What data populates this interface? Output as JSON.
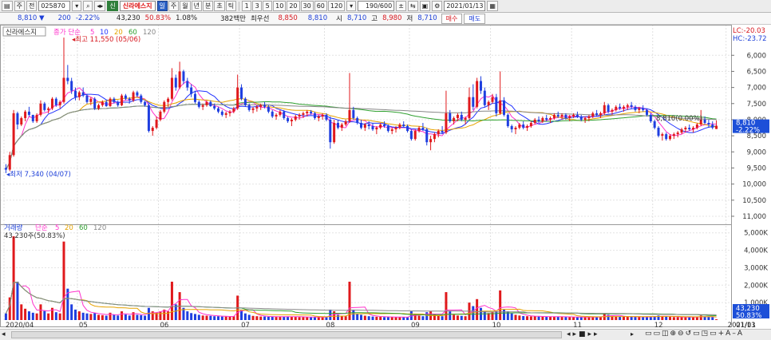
{
  "toolbar": {
    "market": "주",
    "board": "전",
    "code": "025870",
    "badge": "신",
    "stock_name": "신라에스지",
    "periods": [
      "일",
      "주",
      "월",
      "년",
      "분",
      "초",
      "틱"
    ],
    "active_period": "일",
    "intervals": [
      "1",
      "3",
      "5",
      "10",
      "20",
      "30",
      "60",
      "120"
    ],
    "count": "190/600",
    "date": "2021/01/13"
  },
  "quote": {
    "price": "8,810",
    "direction": "▼",
    "change": "200",
    "change_rate": "-2.22%",
    "volume": "43,230",
    "volume_ratio": "50.83%",
    "turnover": "1.08%",
    "amount": "382백만",
    "pref_label": "최우선",
    "ask": "8,850",
    "bid": "8,810",
    "open_label": "시",
    "open": "8,710",
    "high_label": "고",
    "high": "8,980",
    "low_label": "저",
    "low": "8,710",
    "buy_label": "매수",
    "sell_label": "매도"
  },
  "price_panel": {
    "stock_label": "신라에스지",
    "ma_title": "종가 단순",
    "ma_periods": [
      "5",
      "10",
      "20",
      "60",
      "120"
    ],
    "ma_colors": [
      "#ff33cc",
      "#2233ff",
      "#e6a300",
      "#2fa02f",
      "#888888"
    ],
    "lc": "LC:-20.03",
    "hc": "HC:-23.72",
    "max_note": "최고 11,550 (05/06)",
    "min_note": "최저 7,340 (04/07)",
    "mid_note": "8,810(0.00%)",
    "y_ticks": [
      "11,000",
      "10,500",
      "10,000",
      "9,500",
      "9,000",
      "8,500",
      "8,000",
      "7,500",
      "7,000",
      "6,500",
      "6,000"
    ],
    "current_price": "8,810",
    "current_rate": "-2.22%"
  },
  "volume_panel": {
    "title": "거래량",
    "ma_title": "단순",
    "ma_periods": [
      "5",
      "20",
      "60",
      "120"
    ],
    "current_note": "43,230주(50.83%)",
    "y_ticks": [
      "5,000K",
      "4,000K",
      "3,000K",
      "2,000K",
      "1,000K"
    ],
    "current_volume": "43,230",
    "current_rate": "50.83%"
  },
  "x_axis": {
    "labels": [
      "2020/04",
      "05",
      "06",
      "07",
      "08",
      "09",
      "10",
      "11",
      "12",
      "2021/01"
    ],
    "right_label": "01/13"
  },
  "chart_data": {
    "type": "candlestick",
    "title": "",
    "period": "2020/04 ~ 2021/01/13",
    "price_axis": {
      "ylim": [
        5900,
        11800
      ],
      "ticks": [
        6000,
        6500,
        7000,
        7500,
        8000,
        8500,
        9000,
        9500,
        10000,
        10500,
        11000
      ]
    },
    "volume_axis": {
      "ylim": [
        0,
        5400
      ],
      "unit": "K",
      "ticks": [
        1000,
        2000,
        3000,
        4000,
        5000
      ]
    },
    "candles": [
      [
        7500,
        7620,
        7340,
        7450,
        380
      ],
      [
        7450,
        8000,
        7400,
        7900,
        1300
      ],
      [
        7900,
        9300,
        7850,
        9200,
        4800
      ],
      [
        9200,
        9250,
        8700,
        8850,
        2200
      ],
      [
        8850,
        9100,
        8800,
        9050,
        900
      ],
      [
        9050,
        9300,
        8950,
        9250,
        650
      ],
      [
        9250,
        9400,
        9100,
        9150,
        500
      ],
      [
        9150,
        9150,
        8900,
        8950,
        420
      ],
      [
        8950,
        9200,
        8900,
        9150,
        380
      ],
      [
        9150,
        9600,
        9100,
        9500,
        900
      ],
      [
        9500,
        9550,
        9250,
        9300,
        520
      ],
      [
        9300,
        9400,
        9200,
        9350,
        380
      ],
      [
        9350,
        9700,
        9300,
        9650,
        700
      ],
      [
        9650,
        9700,
        9400,
        9450,
        450
      ],
      [
        9450,
        9600,
        9350,
        9550,
        380
      ],
      [
        9550,
        11550,
        9500,
        10300,
        4500
      ],
      [
        10300,
        10700,
        10100,
        10200,
        1800
      ],
      [
        10200,
        10300,
        9800,
        9900,
        900
      ],
      [
        9900,
        10000,
        9600,
        9700,
        600
      ],
      [
        9700,
        9900,
        9600,
        9850,
        500
      ],
      [
        9850,
        10000,
        9700,
        9750,
        420
      ],
      [
        9750,
        9800,
        9500,
        9550,
        380
      ],
      [
        9550,
        9700,
        9450,
        9650,
        350
      ],
      [
        9650,
        9700,
        9300,
        9350,
        400
      ],
      [
        9350,
        9500,
        9300,
        9450,
        300
      ],
      [
        9450,
        9600,
        9400,
        9550,
        280
      ],
      [
        9550,
        9600,
        9400,
        9420,
        250
      ],
      [
        9420,
        9700,
        9400,
        9650,
        420
      ],
      [
        9650,
        9700,
        9500,
        9550,
        300
      ],
      [
        9550,
        9600,
        9400,
        9450,
        260
      ],
      [
        9450,
        9800,
        9420,
        9750,
        500
      ],
      [
        9750,
        9800,
        9600,
        9650,
        320
      ],
      [
        9650,
        9700,
        9500,
        9600,
        260
      ],
      [
        9600,
        9900,
        9550,
        9850,
        450
      ],
      [
        9850,
        9900,
        9700,
        9750,
        300
      ],
      [
        9750,
        9800,
        9500,
        9550,
        280
      ],
      [
        9550,
        9600,
        9400,
        9450,
        250
      ],
      [
        9450,
        9500,
        8600,
        8650,
        700
      ],
      [
        8650,
        8800,
        8500,
        8750,
        500
      ],
      [
        8750,
        9100,
        8700,
        9000,
        420
      ],
      [
        9000,
        9300,
        8950,
        9250,
        500
      ],
      [
        9250,
        9600,
        9200,
        9550,
        600
      ],
      [
        9550,
        9700,
        9400,
        9650,
        500
      ],
      [
        9650,
        10600,
        9600,
        10300,
        2200
      ],
      [
        10300,
        10400,
        9900,
        10000,
        900
      ],
      [
        10000,
        10800,
        9950,
        10500,
        1600
      ],
      [
        10500,
        10550,
        10100,
        10200,
        700
      ],
      [
        10200,
        10300,
        9900,
        10000,
        500
      ],
      [
        10000,
        10100,
        9700,
        9800,
        400
      ],
      [
        9800,
        9900,
        9500,
        9550,
        350
      ],
      [
        9550,
        9600,
        9350,
        9400,
        300
      ],
      [
        9400,
        9500,
        9300,
        9450,
        260
      ],
      [
        9450,
        9600,
        9400,
        9550,
        250
      ],
      [
        9550,
        9600,
        9400,
        9420,
        240
      ],
      [
        9420,
        9500,
        9300,
        9350,
        220
      ],
      [
        9350,
        9400,
        9200,
        9250,
        220
      ],
      [
        9250,
        9300,
        9100,
        9150,
        200
      ],
      [
        9150,
        9250,
        9050,
        9200,
        200
      ],
      [
        9200,
        9300,
        9100,
        9250,
        190
      ],
      [
        9250,
        9400,
        9200,
        9350,
        220
      ],
      [
        9350,
        10400,
        9300,
        10000,
        1400
      ],
      [
        10000,
        10100,
        9600,
        9650,
        600
      ],
      [
        9650,
        9700,
        9400,
        9450,
        380
      ],
      [
        9450,
        9500,
        9250,
        9300,
        300
      ],
      [
        9300,
        9400,
        9200,
        9350,
        240
      ],
      [
        9350,
        9450,
        9250,
        9400,
        220
      ],
      [
        9400,
        9500,
        9300,
        9450,
        200
      ],
      [
        9450,
        9550,
        9350,
        9400,
        200
      ],
      [
        9400,
        9450,
        9200,
        9250,
        190
      ],
      [
        9250,
        9300,
        9050,
        9100,
        200
      ],
      [
        9100,
        9200,
        9000,
        9150,
        180
      ],
      [
        9150,
        9300,
        9100,
        9250,
        200
      ],
      [
        9250,
        9300,
        9000,
        9050,
        200
      ],
      [
        9050,
        9100,
        8900,
        8950,
        210
      ],
      [
        8950,
        9050,
        8800,
        9000,
        200
      ],
      [
        9000,
        9150,
        8950,
        9100,
        180
      ],
      [
        9100,
        9200,
        9000,
        9150,
        170
      ],
      [
        9150,
        9250,
        9050,
        9200,
        170
      ],
      [
        9200,
        9300,
        9100,
        9250,
        180
      ],
      [
        9250,
        9300,
        9150,
        9200,
        160
      ],
      [
        9200,
        9250,
        9000,
        9050,
        170
      ],
      [
        9050,
        9150,
        8950,
        9100,
        160
      ],
      [
        9100,
        9200,
        9000,
        9150,
        160
      ],
      [
        9150,
        9200,
        8950,
        9000,
        180
      ],
      [
        9000,
        9100,
        8100,
        8300,
        600
      ],
      [
        8300,
        9000,
        8250,
        8900,
        500
      ],
      [
        8900,
        9000,
        8700,
        8750,
        300
      ],
      [
        8750,
        8900,
        8650,
        8850,
        250
      ],
      [
        8850,
        9000,
        8800,
        8950,
        220
      ],
      [
        8950,
        10450,
        8900,
        9300,
        2200
      ],
      [
        9300,
        9400,
        9000,
        9050,
        600
      ],
      [
        9050,
        9100,
        8850,
        8900,
        350
      ],
      [
        8900,
        9000,
        8700,
        8750,
        300
      ],
      [
        8750,
        8900,
        8650,
        8850,
        250
      ],
      [
        8850,
        8950,
        8700,
        8800,
        220
      ],
      [
        8800,
        8900,
        8650,
        8700,
        200
      ],
      [
        8700,
        8800,
        8550,
        8750,
        190
      ],
      [
        8750,
        8900,
        8700,
        8850,
        180
      ],
      [
        8850,
        8950,
        8750,
        8800,
        170
      ],
      [
        8800,
        8850,
        8600,
        8650,
        180
      ],
      [
        8650,
        8750,
        8550,
        8700,
        170
      ],
      [
        8700,
        8800,
        8600,
        8750,
        160
      ],
      [
        8750,
        8900,
        8700,
        8850,
        170
      ],
      [
        8850,
        8950,
        8750,
        8800,
        160
      ],
      [
        8800,
        8850,
        8600,
        8650,
        170
      ],
      [
        8650,
        8700,
        8350,
        8400,
        500
      ],
      [
        8400,
        8700,
        8350,
        8650,
        350
      ],
      [
        8650,
        8800,
        8600,
        8750,
        250
      ],
      [
        8750,
        8900,
        8650,
        8700,
        220
      ],
      [
        8700,
        8750,
        8200,
        8300,
        450
      ],
      [
        8300,
        8500,
        8050,
        8400,
        500
      ],
      [
        8400,
        8600,
        8300,
        8550,
        300
      ],
      [
        8550,
        8700,
        8450,
        8650,
        250
      ],
      [
        8650,
        8800,
        8550,
        8600,
        220
      ],
      [
        8600,
        9900,
        8550,
        9200,
        1600
      ],
      [
        9200,
        9300,
        8900,
        8950,
        500
      ],
      [
        8950,
        9100,
        8850,
        9050,
        300
      ],
      [
        9050,
        9200,
        8950,
        9150,
        260
      ],
      [
        9150,
        9250,
        8950,
        9000,
        240
      ],
      [
        9000,
        9100,
        8850,
        9050,
        220
      ],
      [
        9050,
        10000,
        9000,
        9700,
        1000
      ],
      [
        9700,
        10100,
        9300,
        9400,
        800
      ],
      [
        9400,
        10300,
        9350,
        10200,
        1200
      ],
      [
        10200,
        10350,
        9800,
        9900,
        700
      ],
      [
        9900,
        10000,
        9400,
        9450,
        500
      ],
      [
        9450,
        9600,
        9300,
        9550,
        400
      ],
      [
        9550,
        9800,
        9500,
        9700,
        450
      ],
      [
        9700,
        9800,
        9100,
        9200,
        500
      ],
      [
        9200,
        10500,
        9150,
        9600,
        1700
      ],
      [
        9600,
        9700,
        9100,
        9150,
        600
      ],
      [
        9150,
        9200,
        8750,
        8800,
        500
      ],
      [
        8800,
        8850,
        8600,
        8700,
        380
      ],
      [
        8700,
        8800,
        8550,
        8750,
        300
      ],
      [
        8750,
        8900,
        8700,
        8850,
        260
      ],
      [
        8850,
        8950,
        8700,
        8750,
        230
      ],
      [
        8750,
        8850,
        8650,
        8800,
        220
      ],
      [
        8800,
        8950,
        8750,
        8900,
        210
      ],
      [
        8900,
        9050,
        8850,
        9000,
        210
      ],
      [
        9000,
        9100,
        8900,
        8950,
        200
      ],
      [
        8950,
        9100,
        8900,
        9050,
        200
      ],
      [
        9050,
        9150,
        8950,
        9000,
        190
      ],
      [
        9000,
        9100,
        8900,
        9050,
        190
      ],
      [
        9050,
        9200,
        9000,
        9150,
        200
      ],
      [
        9150,
        9250,
        9050,
        9100,
        190
      ],
      [
        9100,
        9200,
        9000,
        9150,
        180
      ],
      [
        9150,
        9200,
        9000,
        9050,
        180
      ],
      [
        9050,
        9150,
        8950,
        9100,
        170
      ],
      [
        9100,
        9200,
        9050,
        9150,
        170
      ],
      [
        9150,
        9250,
        9050,
        9100,
        170
      ],
      [
        9100,
        9150,
        8950,
        9000,
        180
      ],
      [
        9000,
        9100,
        8900,
        9050,
        170
      ],
      [
        9050,
        9150,
        8950,
        9100,
        170
      ],
      [
        9100,
        9250,
        9050,
        9200,
        180
      ],
      [
        9200,
        9300,
        9100,
        9150,
        170
      ],
      [
        9150,
        9250,
        9050,
        9200,
        170
      ],
      [
        9200,
        9550,
        9150,
        9450,
        400
      ],
      [
        9450,
        9500,
        9200,
        9250,
        300
      ],
      [
        9250,
        9350,
        9150,
        9300,
        220
      ],
      [
        9300,
        9450,
        9250,
        9400,
        210
      ],
      [
        9400,
        9500,
        9300,
        9350,
        200
      ],
      [
        9350,
        9450,
        9250,
        9400,
        190
      ],
      [
        9400,
        9500,
        9300,
        9450,
        190
      ],
      [
        9450,
        9550,
        9350,
        9400,
        190
      ],
      [
        9400,
        9450,
        9250,
        9300,
        180
      ],
      [
        9300,
        9400,
        9200,
        9350,
        180
      ],
      [
        9350,
        9450,
        9250,
        9300,
        170
      ],
      [
        9300,
        9350,
        9100,
        9150,
        180
      ],
      [
        9150,
        9200,
        8900,
        8950,
        200
      ],
      [
        8950,
        9000,
        8700,
        8750,
        220
      ],
      [
        8750,
        8800,
        8450,
        8500,
        260
      ],
      [
        8500,
        8600,
        8350,
        8550,
        220
      ],
      [
        8550,
        8600,
        8350,
        8400,
        200
      ],
      [
        8400,
        8550,
        8350,
        8500,
        180
      ],
      [
        8500,
        8600,
        8400,
        8550,
        170
      ],
      [
        8550,
        8650,
        8450,
        8600,
        170
      ],
      [
        8600,
        8750,
        8550,
        8700,
        180
      ],
      [
        8700,
        8800,
        8600,
        8750,
        170
      ],
      [
        8750,
        8850,
        8650,
        8700,
        170
      ],
      [
        8700,
        8800,
        8600,
        8750,
        160
      ],
      [
        8750,
        8900,
        8700,
        8850,
        170
      ],
      [
        8850,
        9300,
        8800,
        9000,
        260
      ],
      [
        9000,
        9100,
        8850,
        8900,
        200
      ],
      [
        8900,
        9000,
        8750,
        8850,
        180
      ],
      [
        8850,
        8950,
        8700,
        8750,
        170
      ],
      [
        8710,
        8980,
        8710,
        8810,
        43
      ]
    ]
  }
}
